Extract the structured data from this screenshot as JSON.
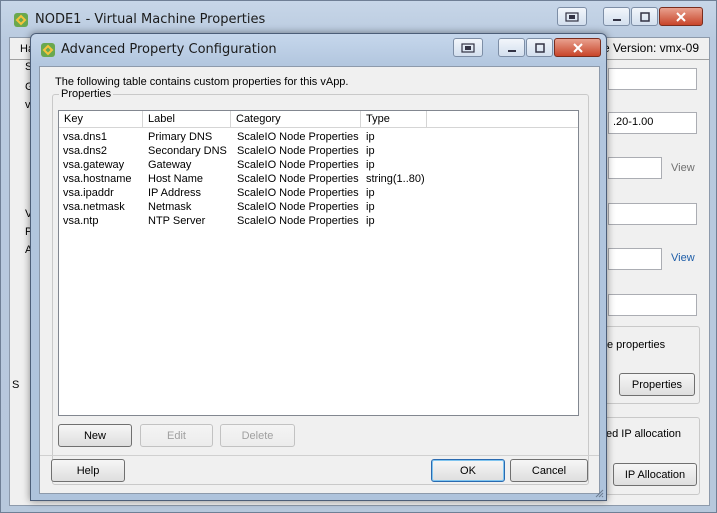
{
  "background_window": {
    "title": "NODE1 - Virtual Machine Properties",
    "tab_partial": "Ha",
    "version_text": "e Version: vmx-09",
    "field_value": ".20-1.00",
    "view_link_1": "View",
    "view_link_2": "View",
    "properties_text": "e properties",
    "properties_button": "Properties",
    "ip_allocation_text": "ed IP allocation",
    "ip_allocation_button": "IP Allocation",
    "left_letters": [
      "S",
      "G",
      "v",
      "V",
      "P",
      "A",
      "S"
    ]
  },
  "dialog": {
    "title": "Advanced Property Configuration",
    "intro_text": "The following table contains custom properties for this vApp.",
    "group_label": "Properties",
    "columns": [
      "Key",
      "Label",
      "Category",
      "Type"
    ],
    "rows": [
      {
        "key": "vsa.dns1",
        "label": "Primary DNS",
        "category": "ScaleIO Node Properties",
        "type": "ip"
      },
      {
        "key": "vsa.dns2",
        "label": "Secondary DNS",
        "category": "ScaleIO Node Properties",
        "type": "ip"
      },
      {
        "key": "vsa.gateway",
        "label": "Gateway",
        "category": "ScaleIO Node Properties",
        "type": "ip"
      },
      {
        "key": "vsa.hostname",
        "label": "Host Name",
        "category": "ScaleIO Node Properties",
        "type": "string(1..80)"
      },
      {
        "key": "vsa.ipaddr",
        "label": "IP Address",
        "category": "ScaleIO Node Properties",
        "type": "ip"
      },
      {
        "key": "vsa.netmask",
        "label": "Netmask",
        "category": "ScaleIO Node Properties",
        "type": "ip"
      },
      {
        "key": "vsa.ntp",
        "label": "NTP Server",
        "category": "ScaleIO Node Properties",
        "type": "ip"
      }
    ],
    "buttons": {
      "new": "New",
      "edit": "Edit",
      "delete": "Delete",
      "help": "Help",
      "ok": "OK",
      "cancel": "Cancel"
    }
  },
  "colors": {
    "titlebar": "#b9cadf",
    "close_button": "#c8452a",
    "link": "#1f5ea8"
  }
}
